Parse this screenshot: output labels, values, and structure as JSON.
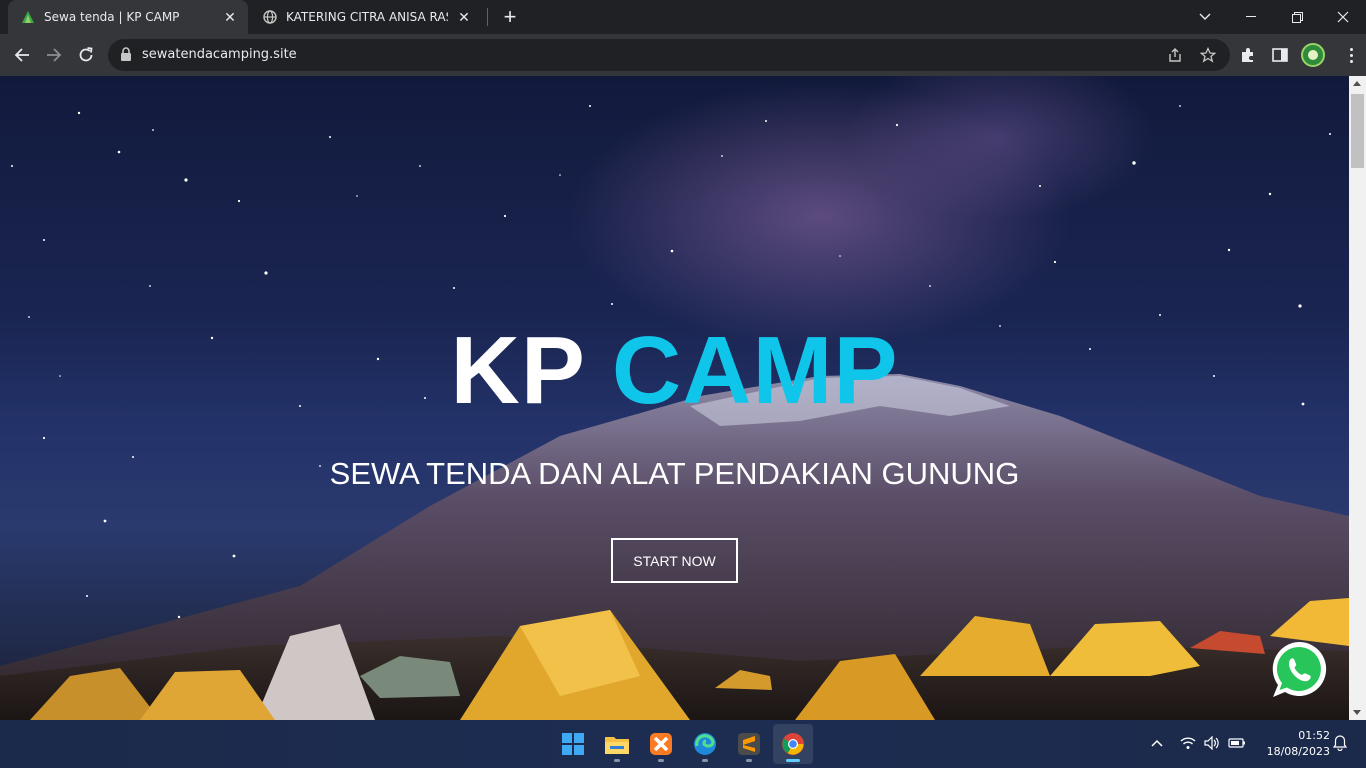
{
  "browser": {
    "tabs": [
      {
        "title": "Sewa tenda | KP CAMP",
        "icon": "tent-favicon-icon",
        "active": true
      },
      {
        "title": "KATERING CITRA ANISA RASA | P",
        "icon": "globe-icon",
        "active": false
      }
    ],
    "url": "sewatendacamping.site",
    "window_controls": [
      "chevron-down-icon",
      "minimize-icon",
      "restore-icon",
      "close-icon"
    ]
  },
  "hero": {
    "title_part1": "KP",
    "title_part2": "CAMP",
    "subtitle": "SEWA TENDA DAN ALAT PENDAKIAN GUNUNG",
    "button_label": "START NOW",
    "accent_color": "#0fc5ea"
  },
  "floating": {
    "whatsapp_icon": "whatsapp-icon",
    "whatsapp_color": "#ffffff"
  },
  "taskbar": {
    "apps": [
      "windows-start-icon",
      "file-explorer-icon",
      "xampp-icon",
      "edge-icon",
      "sublime-text-icon",
      "chrome-icon"
    ],
    "time": "01:52",
    "date": "18/08/2023"
  }
}
